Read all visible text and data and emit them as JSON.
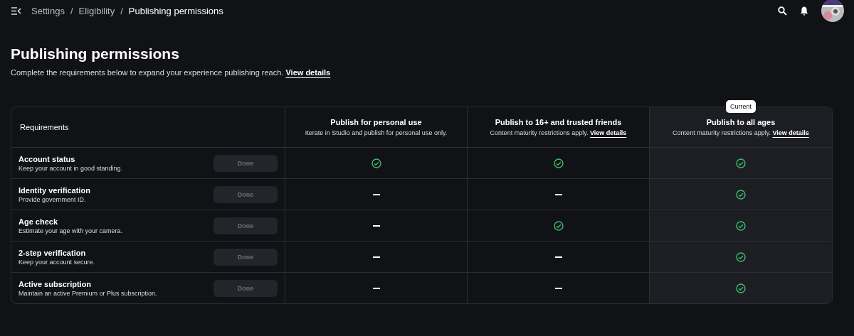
{
  "breadcrumb_separator": "/",
  "breadcrumb": [
    {
      "label": "Settings",
      "selected": false
    },
    {
      "label": "Eligibility",
      "selected": false
    },
    {
      "label": "Publishing permissions",
      "selected": true
    }
  ],
  "page": {
    "title": "Publishing permissions",
    "description": "Complete the requirements below to expand your experience publishing reach.",
    "link": "View details"
  },
  "table": {
    "requirements_heading": "Requirements",
    "columns": [
      {
        "title": "Publish for personal use",
        "subtitle": "Iterate in Studio and publish for personal use only.",
        "current": false
      },
      {
        "title": "Publish to 16+ and trusted friends",
        "subtitle": "Content maturity restrictions apply.",
        "link": "View details",
        "current": false
      },
      {
        "title": "Publish to all ages",
        "subtitle": "Content maturity restrictions apply.",
        "link": "View details",
        "current": true,
        "badge": "Current"
      }
    ],
    "rows": [
      {
        "title": "Account status",
        "description": "Keep your account in good standing.",
        "button": "Done",
        "disabled": true,
        "cells": [
          true,
          true,
          true
        ]
      },
      {
        "title": "Identity verification",
        "description": "Provide government ID.",
        "button": "Done",
        "disabled": true,
        "cells": [
          false,
          false,
          true
        ]
      },
      {
        "title": "Age check",
        "description": "Estimate your age with your camera.",
        "button": "Done",
        "disabled": true,
        "cells": [
          false,
          true,
          true
        ]
      },
      {
        "title": "2-step verification",
        "description": "Keep your account secure.",
        "button": "Done",
        "disabled": true,
        "cells": [
          false,
          false,
          true
        ]
      },
      {
        "title": "Active subscription",
        "description": "Maintain an active Premium or Plus subscription.",
        "button": "Done",
        "disabled": true,
        "cells": [
          false,
          false,
          true
        ]
      }
    ]
  }
}
